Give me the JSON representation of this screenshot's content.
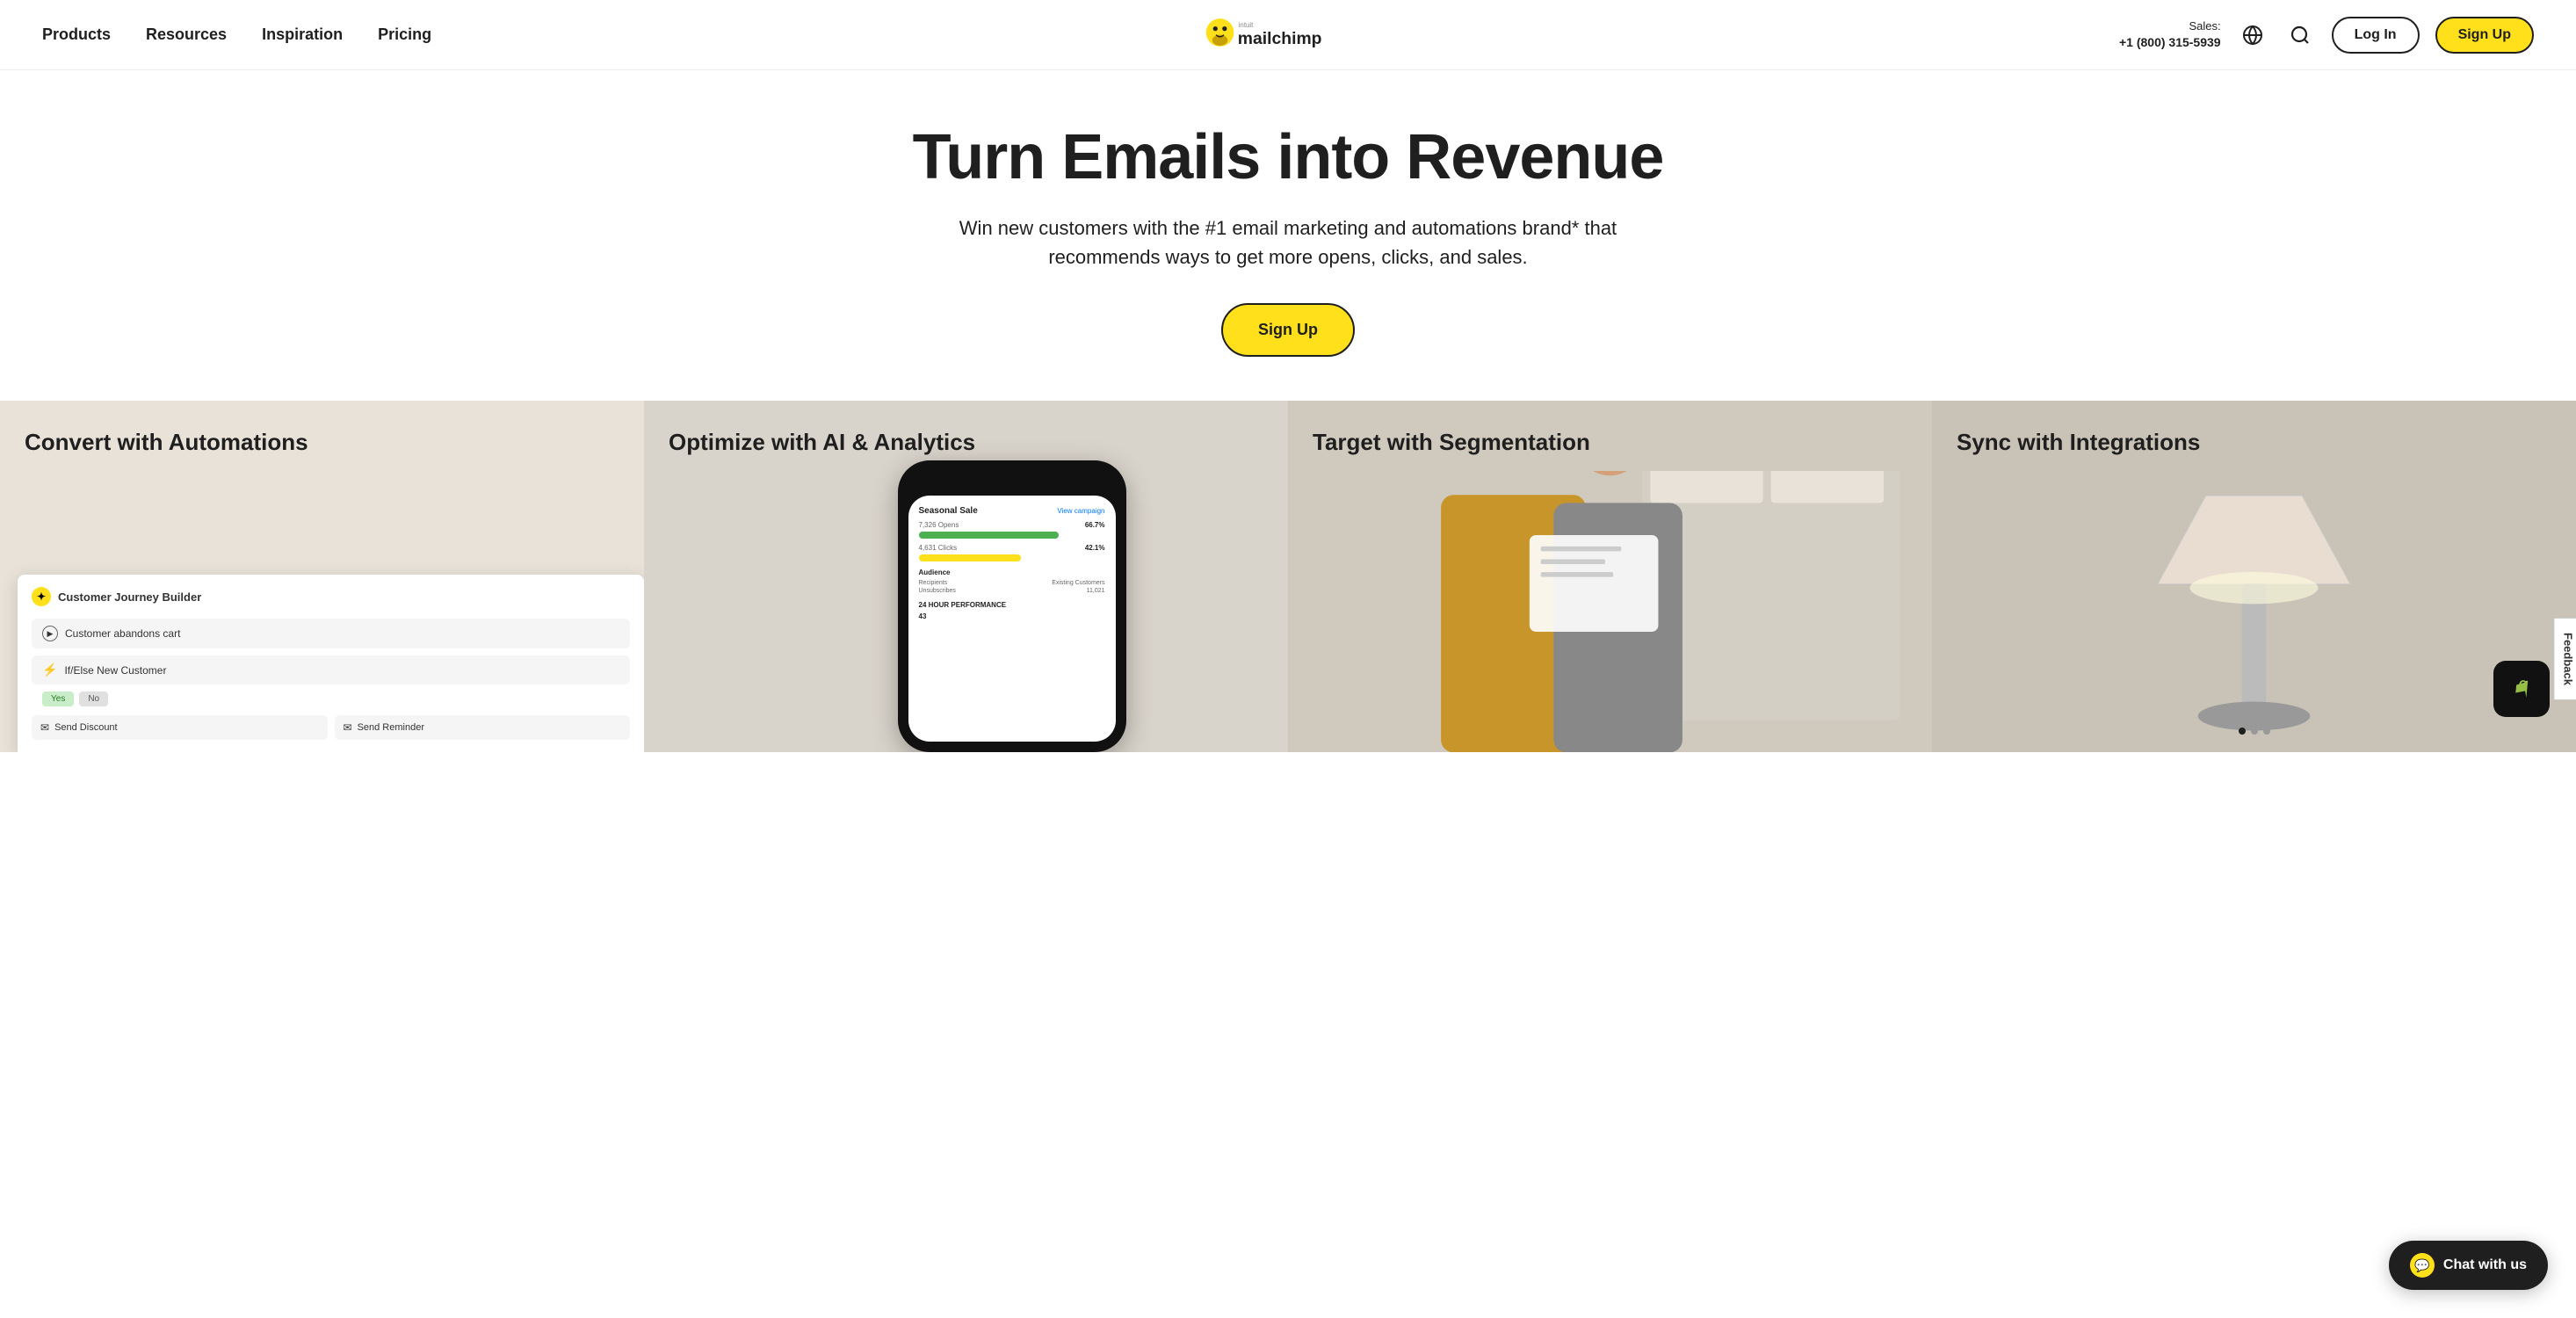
{
  "nav": {
    "items": [
      {
        "label": "Products",
        "id": "products"
      },
      {
        "label": "Resources",
        "id": "resources"
      },
      {
        "label": "Inspiration",
        "id": "inspiration"
      },
      {
        "label": "Pricing",
        "id": "pricing"
      }
    ],
    "sales_label": "Sales:",
    "sales_phone": "+1 (800) 315-5939",
    "login_label": "Log In",
    "signup_label": "Sign Up"
  },
  "hero": {
    "title": "Turn Emails into Revenue",
    "subtitle": "Win new customers with the #1 email marketing and automations brand* that recommends ways to get more opens, clicks, and sales.",
    "cta_label": "Sign Up"
  },
  "features": [
    {
      "id": "automations",
      "title": "Convert with Automations",
      "mockup": {
        "app_title": "Customer Journey Builder",
        "step1": "Customer abandons cart",
        "step2": "If/Else New Customer",
        "branch_yes": "Yes",
        "branch_no": "No",
        "action1": "Send Discount",
        "action2": "Send Reminder"
      }
    },
    {
      "id": "ai",
      "title": "Optimize with AI & Analytics",
      "mockup": {
        "campaign_name": "Seasonal Sale",
        "view_link": "View campaign",
        "opens_label": "7,326 Opens",
        "opens_pct": "66.7%",
        "clicks_label": "4,631 Clicks",
        "clicks_pct": "42.1%",
        "audience_title": "Audience",
        "recipients_label": "Recipients",
        "existing_label": "Existing Customers",
        "unsubs_label": "Unsubscribes",
        "unsubs_val": "11,021",
        "perf_label": "24 HOUR PERFORMANCE",
        "perf_val": "43"
      }
    },
    {
      "id": "segmentation",
      "title": "Target with Segmentation"
    },
    {
      "id": "integrations",
      "title": "Sync with Integrations"
    }
  ],
  "feedback": {
    "label": "Feedback"
  },
  "chat": {
    "label": "Chat with us"
  }
}
